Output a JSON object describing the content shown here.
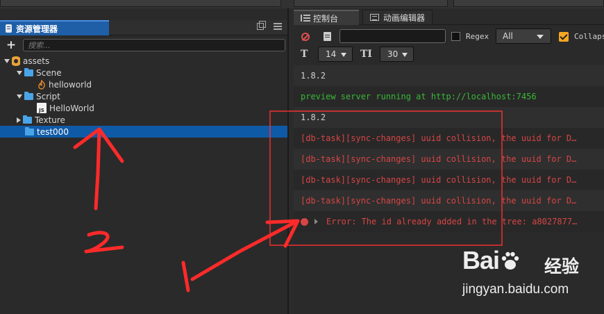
{
  "assets_panel": {
    "tab_label": "资源管理器",
    "search_placeholder": "搜索...",
    "tree": [
      {
        "label": "assets",
        "kind": "database",
        "depth": 0,
        "expanded": true
      },
      {
        "label": "Scene",
        "kind": "folder",
        "depth": 1,
        "expanded": true
      },
      {
        "label": "helloworld",
        "kind": "fire",
        "depth": 2
      },
      {
        "label": "Script",
        "kind": "folder",
        "depth": 1,
        "expanded": true
      },
      {
        "label": "HelloWorld",
        "kind": "js",
        "depth": 2
      },
      {
        "label": "Texture",
        "kind": "folder",
        "depth": 1,
        "expanded": false
      },
      {
        "label": "test000",
        "kind": "folder",
        "depth": 1,
        "selected": true
      }
    ],
    "js_badge": "JS"
  },
  "console_panel": {
    "tabs": [
      {
        "label": "控制台",
        "active": true
      },
      {
        "label": "动画编辑器",
        "active": false
      }
    ],
    "filter_value": "",
    "regex_label": "Regex",
    "log_level": "All",
    "collapse_label": "Collapse",
    "collapse_checked": true,
    "regex_checked": false,
    "font_size": "14",
    "line_height": "30",
    "font_size_icon": "T",
    "line_height_icon": "TI",
    "logs": [
      {
        "text": "1.8.2",
        "level": "log"
      },
      {
        "text": "preview server running at http://localhost:7456",
        "level": "info"
      },
      {
        "text": "1.8.2",
        "level": "log"
      },
      {
        "text": "[db-task][sync-changes] uuid collision, the uuid for D…",
        "level": "error"
      },
      {
        "text": "[db-task][sync-changes] uuid collision, the uuid for D…",
        "level": "error"
      },
      {
        "text": "[db-task][sync-changes] uuid collision, the uuid for D…",
        "level": "error"
      },
      {
        "text": "[db-task][sync-changes] uuid collision, the uuid for D…",
        "level": "error"
      },
      {
        "text": "Error: The id already added in the tree: a8027877…",
        "level": "error",
        "expandable": true
      }
    ]
  },
  "annotations": {
    "label_1": "1",
    "label_2": "2",
    "color": "#ff3030"
  },
  "watermark": {
    "logo_text_left": "Bai",
    "logo_text_right": "经验",
    "url": "jingyan.baidu.com"
  },
  "colors": {
    "selection": "#0f5aa6",
    "tab_accent": "#1f5fa8",
    "error": "#d84545",
    "info": "#38b838",
    "collapse_check": "#f5a623"
  }
}
